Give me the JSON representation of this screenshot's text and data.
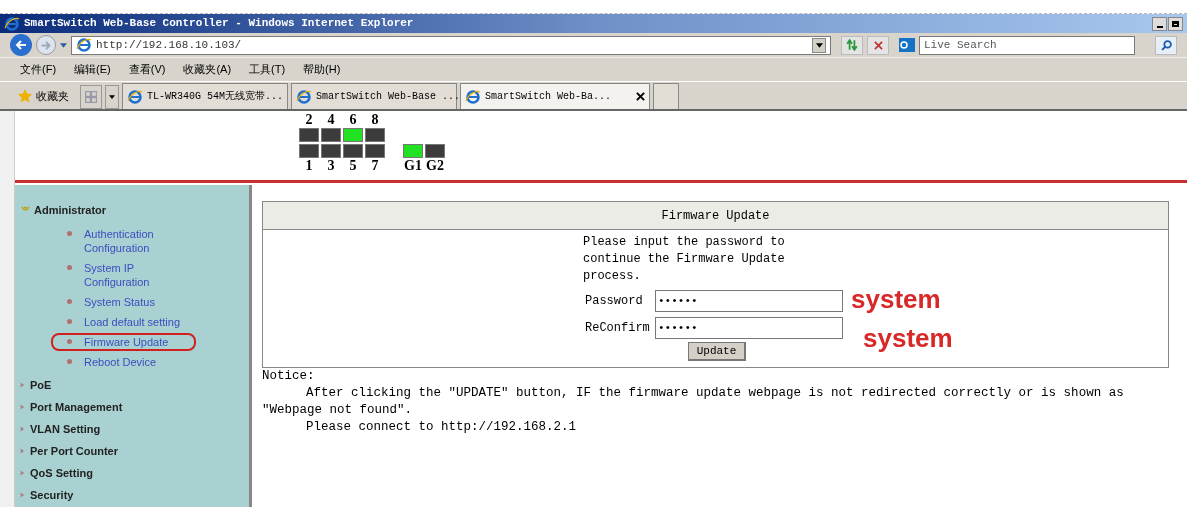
{
  "window": {
    "title": "SmartSwitch Web-Base Controller - Windows Internet Explorer"
  },
  "address_bar": {
    "url": "http://192.168.10.103/"
  },
  "search": {
    "placeholder": "Live Search"
  },
  "menu": [
    "文件(F)",
    "编辑(E)",
    "查看(V)",
    "收藏夹(A)",
    "工具(T)",
    "帮助(H)"
  ],
  "favorites": {
    "label": "收藏夹"
  },
  "tabs": [
    {
      "label": "TL-WR340G 54M无线宽带...",
      "selected": false
    },
    {
      "label": "SmartSwitch Web-Base ...",
      "selected": false
    },
    {
      "label": "SmartSwitch Web-Ba...",
      "selected": true
    }
  ],
  "ports": {
    "top": [
      {
        "label": "2",
        "on": false
      },
      {
        "label": "4",
        "on": false
      },
      {
        "label": "6",
        "on": true
      },
      {
        "label": "8",
        "on": false
      }
    ],
    "bottom": [
      {
        "label": "1",
        "on": false
      },
      {
        "label": "3",
        "on": false
      },
      {
        "label": "5",
        "on": false
      },
      {
        "label": "7",
        "on": false
      }
    ],
    "gigabit": [
      {
        "label": "G1",
        "on": true
      },
      {
        "label": "G2",
        "on": false
      }
    ]
  },
  "sidebar": {
    "items": [
      {
        "label": "Administrator",
        "expanded": true,
        "children": [
          {
            "label": "Authentication Configuration",
            "circled": false
          },
          {
            "label": "System IP Configuration",
            "circled": false
          },
          {
            "label": "System Status",
            "circled": false
          },
          {
            "label": "Load default setting",
            "circled": false
          },
          {
            "label": "Firmware Update",
            "circled": true
          },
          {
            "label": "Reboot Device",
            "circled": false
          }
        ]
      },
      {
        "label": "PoE",
        "expanded": false
      },
      {
        "label": "Port Management",
        "expanded": false
      },
      {
        "label": "VLAN Setting",
        "expanded": false
      },
      {
        "label": "Per Port Counter",
        "expanded": false
      },
      {
        "label": "QoS Setting",
        "expanded": false
      },
      {
        "label": "Security",
        "expanded": false
      }
    ]
  },
  "panel": {
    "title": "Firmware Update",
    "instructions": "Please input the password to continue the Firmware Update process.",
    "fields": [
      {
        "label": "Password",
        "value": "••••••",
        "annotation": "system"
      },
      {
        "label": "ReConfirm",
        "value": "••••••",
        "annotation": "system"
      }
    ],
    "button": "Update"
  },
  "notice": {
    "title": "Notice:",
    "lines": [
      "After clicking the \"UPDATE\" button, IF the firmware update webpage is not redirected correctly or is shown as \"Webpage not found\".",
      "Please connect to http://192.168.2.1"
    ]
  }
}
